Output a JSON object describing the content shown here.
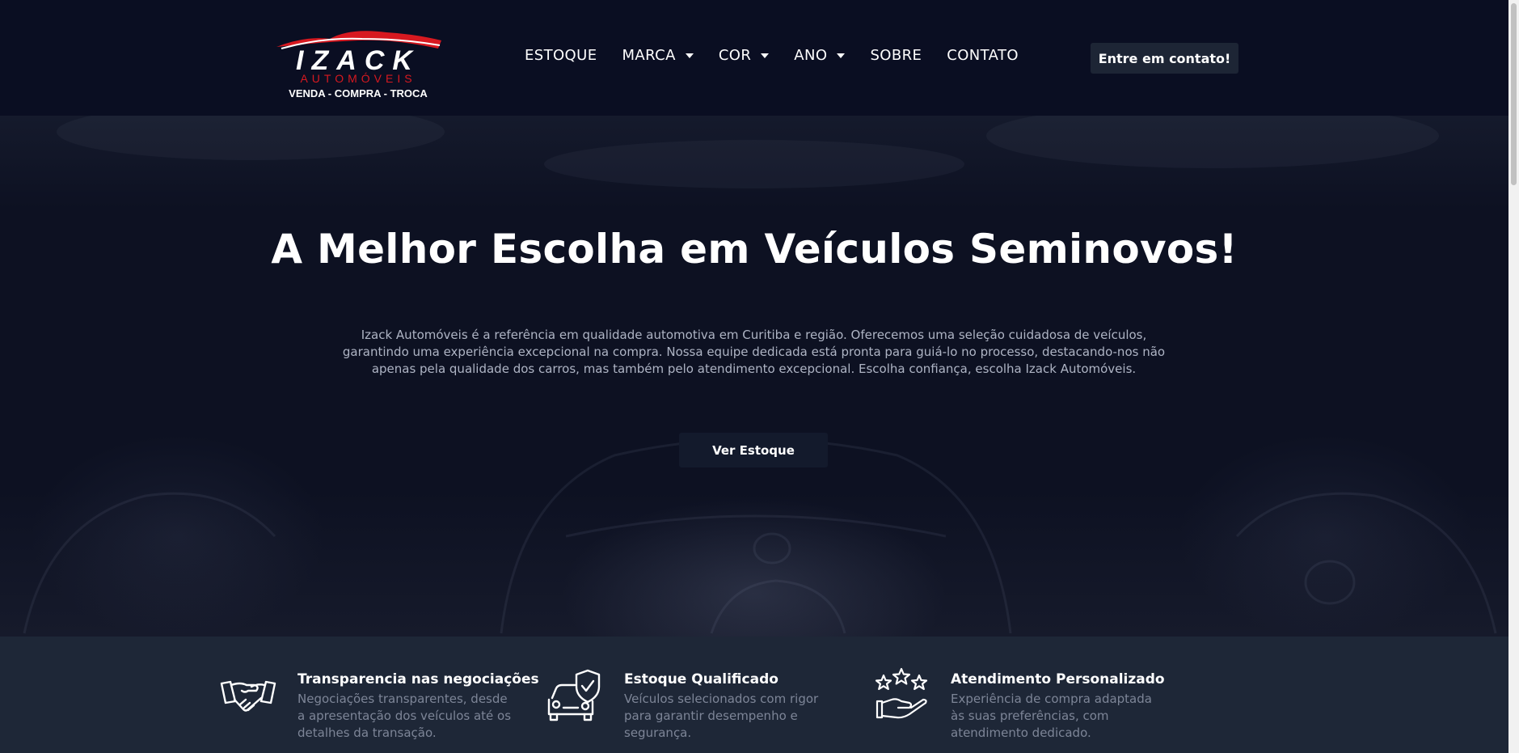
{
  "brand": {
    "name": "IZACK",
    "subtitle": "AUTOMÓVEIS",
    "tagline": "VENDA - COMPRA - TROCA",
    "accent_color": "#d71920"
  },
  "nav": {
    "items": [
      {
        "label": "ESTOQUE",
        "dropdown": false
      },
      {
        "label": "MARCA",
        "dropdown": true
      },
      {
        "label": "COR",
        "dropdown": true
      },
      {
        "label": "ANO",
        "dropdown": true
      },
      {
        "label": "SOBRE",
        "dropdown": false
      },
      {
        "label": "CONTATO",
        "dropdown": false
      }
    ],
    "cta_label": "Entre em contato!"
  },
  "hero": {
    "title": "A Melhor Escolha em Veículos Seminovos!",
    "text": "Izack Automóveis é a referência em qualidade automotiva em Curitiba e região. Oferecemos uma seleção cuidadosa de veículos, garantindo uma experiência excepcional na compra. Nossa equipe dedicada está pronta para guiá-lo no processo, destacando-nos não apenas pela qualidade dos carros, mas também pelo atendimento excepcional. Escolha confiança, escolha Izack Automóveis.",
    "button_label": "Ver Estoque"
  },
  "features": [
    {
      "icon": "handshake-icon",
      "title": "Transparencia nas negociações",
      "desc": "Negociações transparentes, desde a apresentação dos veículos até os detalhes da transação."
    },
    {
      "icon": "car-shield-icon",
      "title": "Estoque Qualificado",
      "desc": "Veículos selecionados com rigor para garantir desempenho e segurança."
    },
    {
      "icon": "stars-hand-icon",
      "title": "Atendimento Personalizado",
      "desc": "Experiência de compra adaptada às suas preferências, com atendimento dedicado."
    }
  ]
}
